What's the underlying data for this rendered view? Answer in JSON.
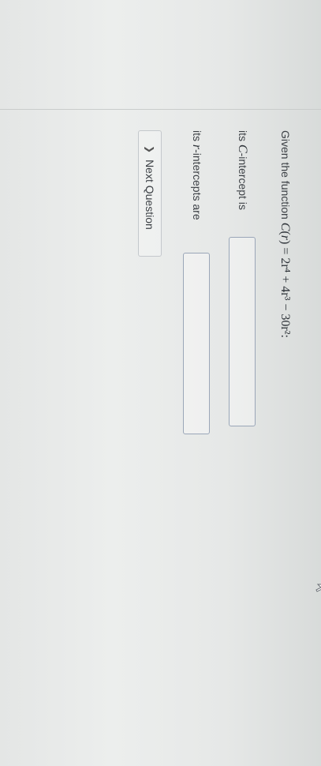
{
  "question": {
    "prefix": "Given the function",
    "function_name": "C",
    "variable": "r",
    "rhs_text": "2r⁴ + 4r³ − 30r²",
    "suffix": ":"
  },
  "c_intercept": {
    "label_prefix": "its",
    "label_var": "C",
    "label_suffix": "-intercept is",
    "value": ""
  },
  "r_intercepts": {
    "label_prefix": "its",
    "label_var": "r",
    "label_suffix": "-intercepts are",
    "value": ""
  },
  "next_button": {
    "label": "Next Question",
    "icon": "chevron-right-icon"
  }
}
